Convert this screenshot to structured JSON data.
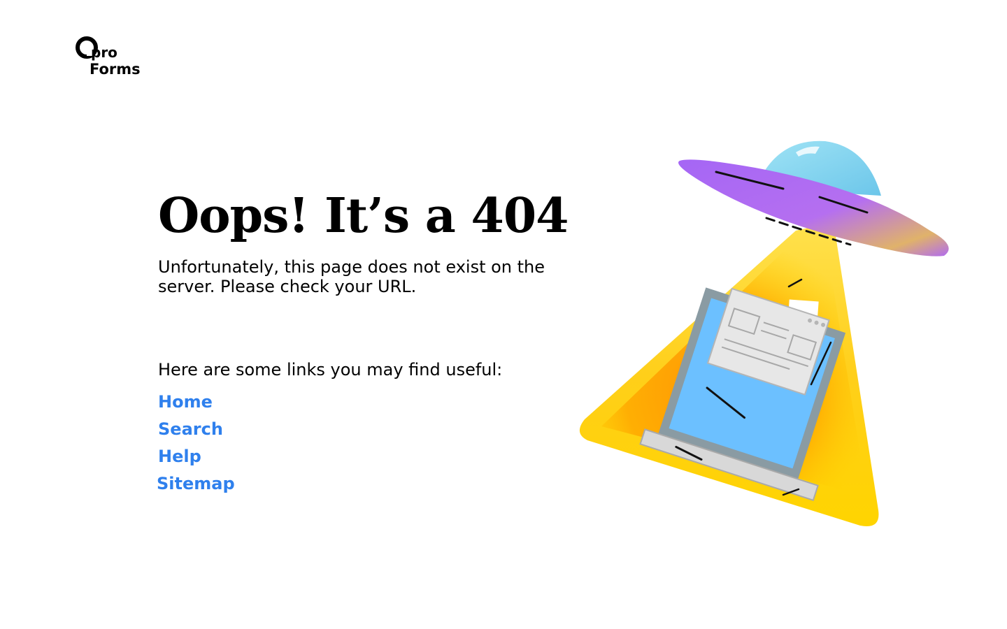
{
  "brand": {
    "logo_line1": "pro",
    "logo_line2": "Forms"
  },
  "error": {
    "title": "Oops! It’s a 404",
    "message": "Unfortunately, this page does not exist on the server. Please check your URL."
  },
  "links": {
    "intro": "Here are some links you may find useful:",
    "items": [
      {
        "label": "Home"
      },
      {
        "label": "Search"
      },
      {
        "label": "Help"
      },
      {
        "label": "Sitemap"
      }
    ]
  },
  "colors": {
    "link": "#2f80ed",
    "ufo_body": "#b06cf5",
    "ufo_dome": "#8dd9f0",
    "beam": "#ffd400",
    "laptop_screen": "#6cc0ff"
  }
}
